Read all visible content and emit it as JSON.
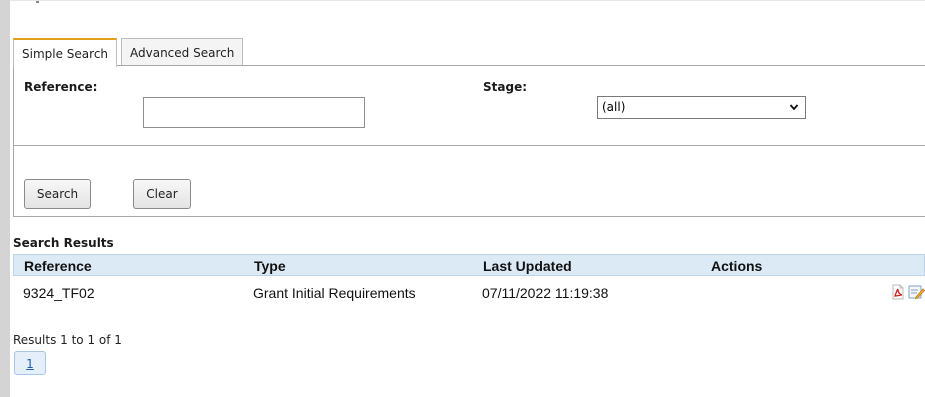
{
  "tabs": [
    {
      "label": "Simple Search",
      "active": true
    },
    {
      "label": "Advanced Search",
      "active": false
    }
  ],
  "form": {
    "reference_label": "Reference:",
    "reference_value": "",
    "stage_label": "Stage:",
    "stage_value": "(all)"
  },
  "buttons": {
    "search_label": "Search",
    "clear_label": "Clear"
  },
  "results": {
    "title": "Search Results",
    "columns": [
      "Reference",
      "Type",
      "Last Updated",
      "Actions"
    ],
    "rows": [
      {
        "reference": "9324_TF02",
        "type": "Grant Initial Requirements",
        "last_updated": "07/11/2022 11:19:38",
        "actions": [
          "pdf-icon",
          "edit-icon"
        ]
      }
    ],
    "count_text": "Results 1 to 1 of 1",
    "pages": [
      "1"
    ]
  },
  "colors": {
    "active_tab_accent": "#e0a01a",
    "header_bg": "#dceaf6",
    "page_button_bg": "#e4effa"
  }
}
